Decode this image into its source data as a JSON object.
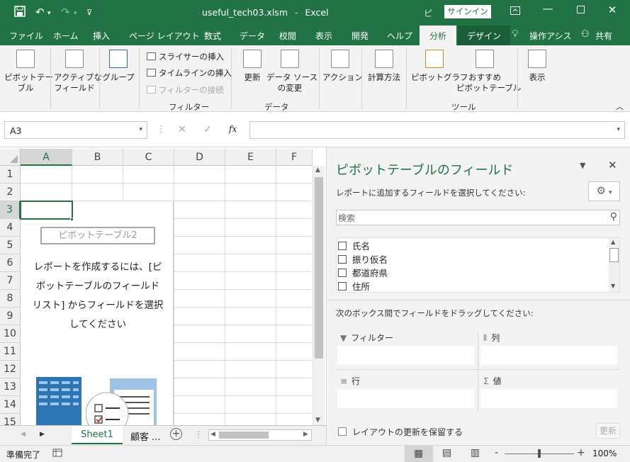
{
  "app": {
    "filename": "useful_tech03.xlsm",
    "separator": "-",
    "app_name": "Excel",
    "title_truncated": "ピ",
    "signin": "サインイン"
  },
  "tabs": [
    {
      "label": "ファイル"
    },
    {
      "label": "ホーム"
    },
    {
      "label": "挿入"
    },
    {
      "label": "ページ レイアウト"
    },
    {
      "label": "数式"
    },
    {
      "label": "データ"
    },
    {
      "label": "校閲"
    },
    {
      "label": "表示"
    },
    {
      "label": "開発"
    },
    {
      "label": "ヘルプ"
    },
    {
      "label": "分析"
    },
    {
      "label": "デザイン"
    },
    {
      "label": "操作アシス"
    },
    {
      "label": "共有"
    }
  ],
  "ribbon": {
    "pivottable_1": "ピボットテー",
    "pivottable_2": "ブル",
    "active_field_1": "アクティブな",
    "active_field_2": "フィールド",
    "group": "グループ",
    "insert_slicer": "スライサーの挿入",
    "insert_timeline": "タイムラインの挿入",
    "filter_connections": "フィルターの接続",
    "filter_group": "フィルター",
    "refresh": "更新",
    "change_source_1": "データ ソース",
    "change_source_2": "の変更",
    "data_group": "データ",
    "actions": "アクション",
    "calculations": "計算方法",
    "pivotchart": "ピボットグラフ",
    "recommended_1": "おすすめ",
    "recommended_2": "ピボットテーブル",
    "tools_group": "ツール",
    "show": "表示"
  },
  "formula_bar": {
    "name_box": "A3",
    "fx": "fx",
    "value": ""
  },
  "grid": {
    "columns": [
      "A",
      "B",
      "C",
      "D",
      "E",
      "F"
    ],
    "rows": [
      "1",
      "2",
      "3",
      "4",
      "5",
      "6",
      "7",
      "8",
      "9",
      "10",
      "11",
      "12",
      "13",
      "14",
      "15"
    ],
    "pivot_name": "ピボットテーブル2",
    "pivot_msg_1": "レポートを作成するには、[ピ",
    "pivot_msg_2": "ボットテーブルのフィールド",
    "pivot_msg_3": "リスト] からフィールドを選択",
    "pivot_msg_4": "してください"
  },
  "sheets": {
    "active": "Sheet1",
    "other": "顧客 ..."
  },
  "panel": {
    "title": "ピボットテーブルのフィールド",
    "subtitle": "レポートに追加するフィールドを選択してください:",
    "search_placeholder": "検索",
    "fields": [
      "氏名",
      "振り仮名",
      "都道府県",
      "住所"
    ],
    "drag_hint": "次のボックス間でフィールドをドラッグしてください:",
    "filter_label": "フィルター",
    "columns_label": "列",
    "rows_label": "行",
    "values_label": "値",
    "defer_label": "レイアウトの更新を保留する",
    "update_button": "更新"
  },
  "status": {
    "ready": "準備完了",
    "zoom": "100%",
    "zoom_minus": "-",
    "zoom_plus": "+"
  },
  "colors": {
    "excel_green": "#217346",
    "design_tab": "#1a5e39"
  }
}
